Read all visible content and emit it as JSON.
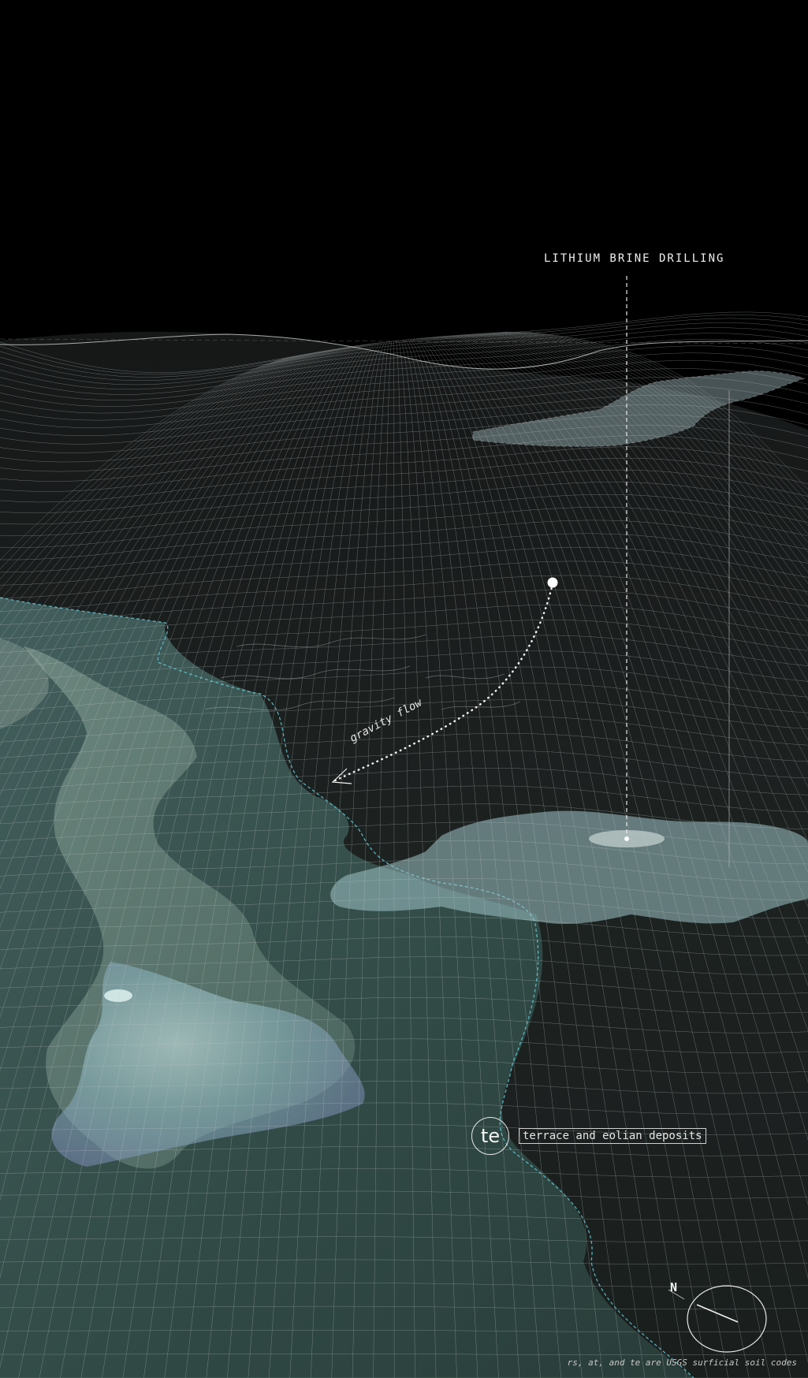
{
  "annotation": {
    "drilling_label": "LITHIUM BRINE DRILLING",
    "flow_label": "gravity flow"
  },
  "legend": {
    "soil_code": "te",
    "soil_name": "terrace and eolian deposits"
  },
  "compass": {
    "north_label": "N"
  },
  "footnote": "rs, at, and te are USGS surficial soil codes",
  "colors": {
    "background": "#000000",
    "grid": "#bfc7c7",
    "deposit_fill": "#3c5a55",
    "brine_pool": "#9fc4c8",
    "contour_dash": "#5fc9d6"
  }
}
